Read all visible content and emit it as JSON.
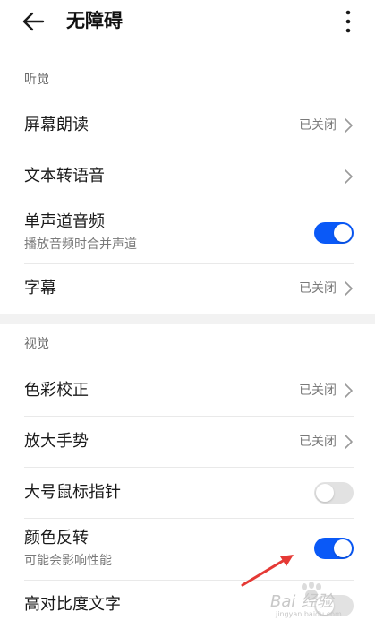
{
  "header": {
    "title": "无障碍",
    "back_icon": "arrow-left-icon",
    "more_icon": "more-vertical-icon"
  },
  "sections": [
    {
      "title": "听觉",
      "items": [
        {
          "label": "屏幕朗读",
          "value": "已关闭",
          "control": "chevron"
        },
        {
          "label": "文本转语音",
          "control": "chevron"
        },
        {
          "label": "单声道音频",
          "subtitle": "播放音频时合并声道",
          "control": "switch",
          "switch_on": true
        },
        {
          "label": "字幕",
          "value": "已关闭",
          "control": "chevron"
        }
      ]
    },
    {
      "title": "视觉",
      "items": [
        {
          "label": "色彩校正",
          "value": "已关闭",
          "control": "chevron"
        },
        {
          "label": "放大手势",
          "value": "已关闭",
          "control": "chevron"
        },
        {
          "label": "大号鼠标指针",
          "control": "switch",
          "switch_on": false
        },
        {
          "label": "颜色反转",
          "subtitle": "可能会影响性能",
          "control": "switch",
          "switch_on": true
        },
        {
          "label": "高对比度文字",
          "control": "switch",
          "switch_on": false
        }
      ]
    }
  ],
  "colors": {
    "switch_on": "#0a59f7",
    "switch_off": "#e2e2e2",
    "annotation_arrow": "#e53935",
    "section_gap": "#f2f2f2"
  },
  "watermark": {
    "text": "Bai 经验",
    "subtext": "jingyan.baidu.com"
  }
}
